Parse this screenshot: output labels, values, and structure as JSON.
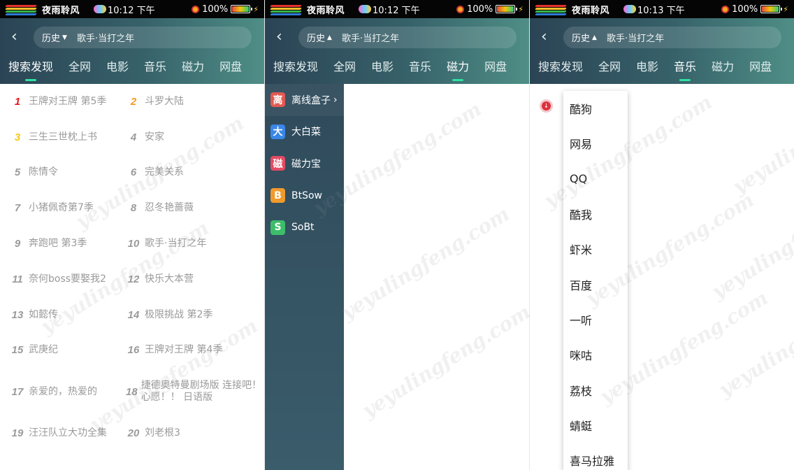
{
  "status": {
    "app_name": "夜雨聆风",
    "battery": "100%",
    "battery_level": 1.0,
    "times": [
      "10:12 下午",
      "10:12 下午",
      "10:13 下午"
    ]
  },
  "header": {
    "history_label": "历史",
    "query": "歌手·当打之年",
    "tabs": [
      "搜索发现",
      "全网",
      "电影",
      "音乐",
      "磁力",
      "网盘"
    ],
    "active_tab_per_panel": [
      "搜索发现",
      "磁力",
      "音乐"
    ],
    "accent_color": "#2fe0a0"
  },
  "hot_left": [
    {
      "num": "1",
      "title": "王牌对王牌 第5季"
    },
    {
      "num": "3",
      "title": "三生三世枕上书"
    },
    {
      "num": "5",
      "title": "陈情令"
    },
    {
      "num": "7",
      "title": "小猪佩奇第7季"
    },
    {
      "num": "9",
      "title": "奔跑吧 第3季"
    },
    {
      "num": "11",
      "title": "奈何boss要娶我2"
    },
    {
      "num": "13",
      "title": "如懿传"
    },
    {
      "num": "15",
      "title": "武庚纪"
    },
    {
      "num": "17",
      "title": "亲爱的，热爱的"
    },
    {
      "num": "19",
      "title": "汪汪队立大功全集"
    }
  ],
  "hot_right": [
    {
      "num": "2",
      "title": "斗罗大陆"
    },
    {
      "num": "4",
      "title": "安家"
    },
    {
      "num": "6",
      "title": "完美关系"
    },
    {
      "num": "8",
      "title": "忍冬艳蔷薇"
    },
    {
      "num": "10",
      "title": "歌手·当打之年"
    },
    {
      "num": "12",
      "title": "快乐大本营"
    },
    {
      "num": "14",
      "title": "极限挑战 第2季"
    },
    {
      "num": "16",
      "title": "王牌对王牌 第4季"
    },
    {
      "num": "18",
      "title": "捷德奥特曼剧场版 连接吧！心愿！！ 日语版"
    },
    {
      "num": "20",
      "title": "刘老根3"
    }
  ],
  "magnet_sources": [
    {
      "label": "离线盒子",
      "icon": "离",
      "color": "#e15a52",
      "icon_name": "offline-box-icon"
    },
    {
      "label": "大白菜",
      "icon": "大",
      "color": "#3a86e8",
      "icon_name": "dabaicai-icon"
    },
    {
      "label": "磁力宝",
      "icon": "磁",
      "color": "#e44a63",
      "icon_name": "cilibao-icon"
    },
    {
      "label": "BtSow",
      "icon": "B",
      "color": "#f09a2c",
      "icon_name": "btsow-icon"
    },
    {
      "label": "SoBt",
      "icon": "S",
      "color": "#3dbd6a",
      "icon_name": "sobt-icon"
    }
  ],
  "music_sources": [
    "酷狗",
    "网易",
    "QQ",
    "酷我",
    "虾米",
    "百度",
    "一听",
    "咪咕",
    "荔枝",
    "蜻蜓",
    "喜马拉雅"
  ],
  "watermark": "yeyulingfeng.com"
}
